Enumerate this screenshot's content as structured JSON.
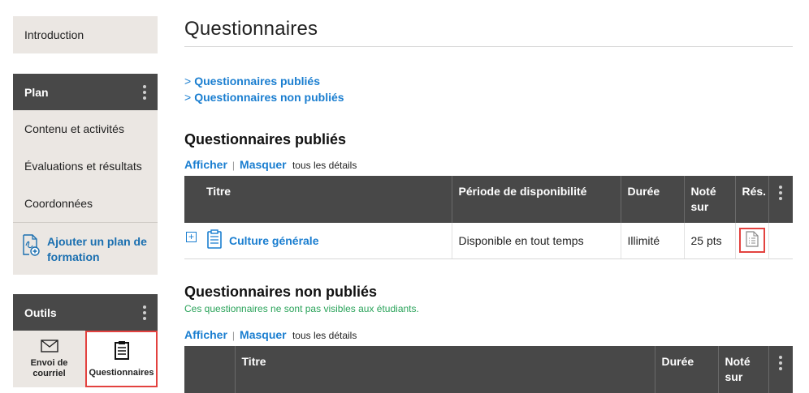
{
  "sidebar": {
    "intro_label": "Introduction",
    "plan": {
      "header": "Plan",
      "items": [
        {
          "label": "Contenu et activités"
        },
        {
          "label": "Évaluations et résultats"
        },
        {
          "label": "Coordonnées"
        }
      ],
      "add_label": "Ajouter un plan de formation"
    },
    "tools": {
      "header": "Outils",
      "items": [
        {
          "label": "Envoi de courriel",
          "icon": "envelope-icon"
        },
        {
          "label": "Questionnaires",
          "icon": "clipboard-icon",
          "active": true
        }
      ]
    }
  },
  "main": {
    "title": "Questionnaires",
    "anchors": [
      "Questionnaires publiés",
      "Questionnaires non publiés"
    ],
    "published": {
      "title": "Questionnaires publiés",
      "show": "Afficher",
      "hide": "Masquer",
      "details": "tous les détails",
      "columns": [
        "Titre",
        "Période de disponibilité",
        "Durée",
        "Noté sur",
        "Rés."
      ],
      "rows": [
        {
          "title": "Culture générale",
          "period": "Disponible en tout temps",
          "duration": "Illimité",
          "score": "25 pts"
        }
      ]
    },
    "unpublished": {
      "title": "Questionnaires non publiés",
      "notice": "Ces questionnaires ne sont pas visibles aux étudiants.",
      "show": "Afficher",
      "hide": "Masquer",
      "details": "tous les détails",
      "columns": [
        "Titre",
        "Durée",
        "Noté sur"
      ]
    }
  },
  "colors": {
    "link": "#1a7ed0",
    "header_bg": "#484848",
    "sidebar_bg": "#ebe7e3",
    "highlight": "#e3423f",
    "notice": "#2aa35a"
  }
}
